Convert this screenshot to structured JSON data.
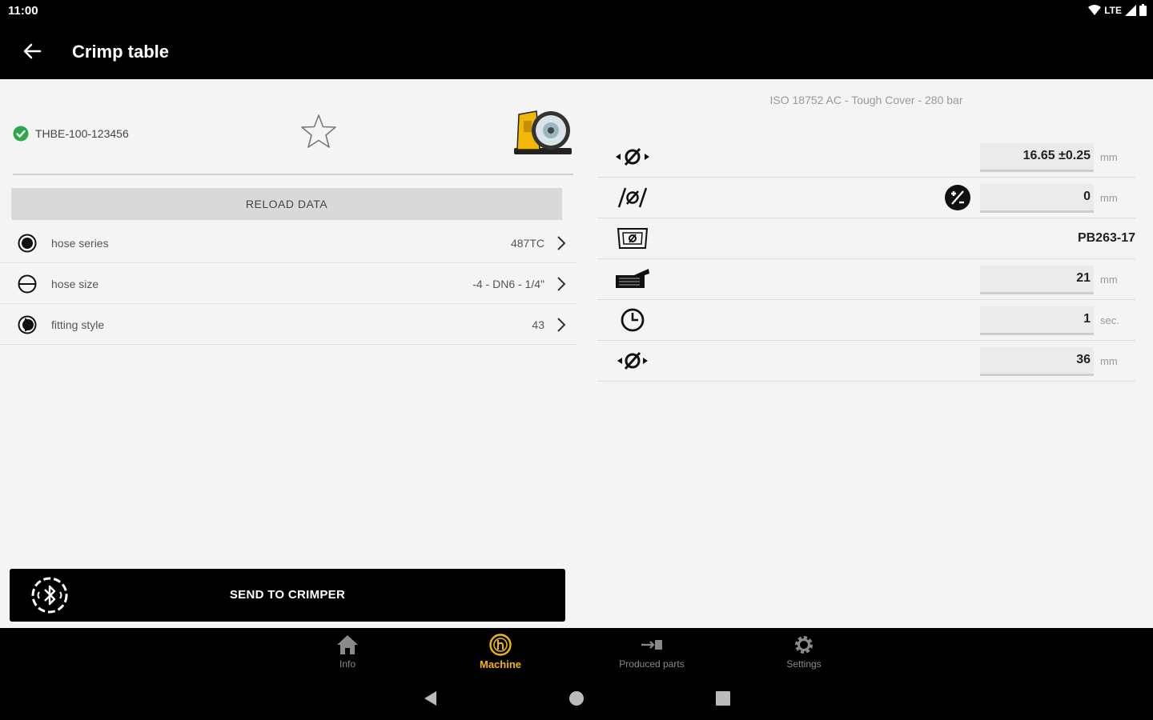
{
  "status_bar": {
    "time": "11:00",
    "network": "LTE"
  },
  "app_bar": {
    "title": "Crimp table"
  },
  "left_panel": {
    "tag_id": "THBE-100-123456",
    "reload_label": "RELOAD DATA",
    "options": [
      {
        "label": "hose series",
        "value": "487TC"
      },
      {
        "label": "hose size",
        "value": "-4 - DN6 - 1/4\""
      },
      {
        "label": "fitting style",
        "value": "43"
      }
    ],
    "send_label": "SEND TO CRIMPER"
  },
  "right_panel": {
    "spec_title": "ISO 18752 AC - Tough Cover - 280 bar",
    "params": [
      {
        "icon": "crimp-diameter-icon",
        "value": "16.65 ±0.25",
        "unit": "mm"
      },
      {
        "icon": "diameter-correction-icon",
        "value": "0",
        "unit": "mm"
      },
      {
        "icon": "die-set-icon",
        "value": "PB263-17",
        "unit": ""
      },
      {
        "icon": "crimp-length-icon",
        "value": "21",
        "unit": "mm"
      },
      {
        "icon": "clock-icon",
        "value": "1",
        "unit": "sec."
      },
      {
        "icon": "open-diameter-icon",
        "value": "36",
        "unit": "mm"
      }
    ]
  },
  "bottom_nav": {
    "items": [
      {
        "label": "Info",
        "icon": "home-icon",
        "active": false
      },
      {
        "label": "Machine",
        "icon": "machine-icon",
        "active": true
      },
      {
        "label": "Produced parts",
        "icon": "produced-parts-icon",
        "active": false
      },
      {
        "label": "Settings",
        "icon": "gear-icon",
        "active": false
      }
    ]
  },
  "colors": {
    "accent": "#f2b705",
    "bar": "#000000",
    "check": "#2aa84a"
  }
}
